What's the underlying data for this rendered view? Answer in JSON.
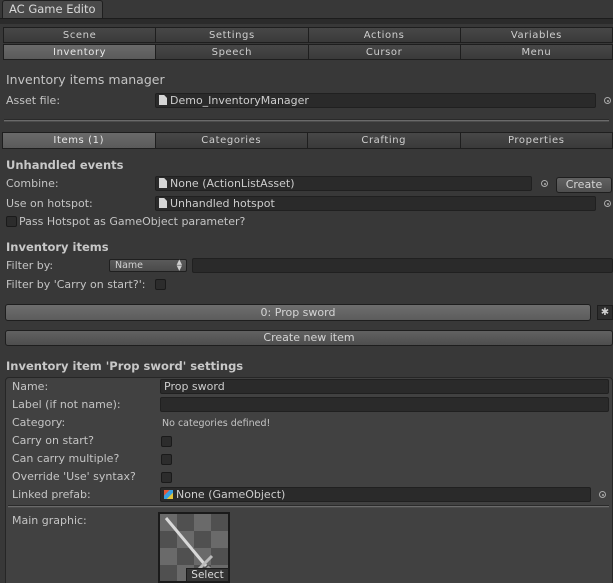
{
  "window": {
    "tab_title": "AC Game Edito"
  },
  "toolbar_rows": [
    [
      "Scene",
      "Settings",
      "Actions",
      "Variables"
    ],
    [
      "Inventory",
      "Speech",
      "Cursor",
      "Menu"
    ]
  ],
  "active_main_tab": "Inventory",
  "manager": {
    "title": "Inventory items manager",
    "asset_label": "Asset file:",
    "asset_value": "Demo_InventoryManager"
  },
  "sub_tabs": [
    "Items (1)",
    "Categories",
    "Crafting",
    "Properties"
  ],
  "active_sub_tab": "Items (1)",
  "unhandled": {
    "heading": "Unhandled events",
    "combine_label": "Combine:",
    "combine_value": "None (ActionListAsset)",
    "create_label": "Create",
    "hotspot_label": "Use on hotspot:",
    "hotspot_value": "Unhandled hotspot",
    "pass_label": "Pass Hotspot as GameObject parameter?"
  },
  "items": {
    "heading": "Inventory items",
    "filter_label": "Filter by:",
    "filter_option": "Name",
    "filter_text": "",
    "carry_filter_label": "Filter by 'Carry on start?':",
    "list": [
      "0: Prop sword"
    ],
    "gear_icon_glyph": "✱",
    "create_new_label": "Create new item"
  },
  "settings": {
    "heading": "Inventory item 'Prop sword' settings",
    "name_label": "Name:",
    "name_value": "Prop sword",
    "alt_label": "Label (if not name):",
    "alt_value": "",
    "category_label": "Category:",
    "category_value": "No categories defined!",
    "carry_label": "Carry on start?",
    "multiple_label": "Can carry multiple?",
    "override_label": "Override 'Use' syntax?",
    "prefab_label": "Linked prefab:",
    "prefab_value": "None (GameObject)",
    "graphic_label": "Main graphic:",
    "graphic_select": "Select"
  }
}
